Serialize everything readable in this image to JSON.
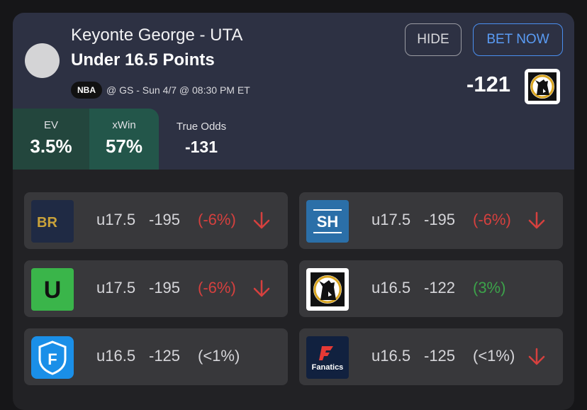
{
  "player": {
    "name": "Keyonte George - UTA",
    "line": "Under 16.5 Points"
  },
  "game": {
    "league": "NBA",
    "info": "@ GS - Sun 4/7 @ 08:30 PM ET"
  },
  "buttons": {
    "hide": "HIDE",
    "bet_now": "BET NOW"
  },
  "best_odds": "-121",
  "stats": {
    "ev": {
      "label": "EV",
      "value": "3.5%"
    },
    "xwin": {
      "label": "xWin",
      "value": "57%"
    },
    "true_odds": {
      "label": "True Odds",
      "value": "-131"
    }
  },
  "books": [
    {
      "logo": "BR",
      "line": "u17.5",
      "odds": "-195",
      "diff": "(-6%)",
      "trend": "down"
    },
    {
      "logo": "SH",
      "line": "u17.5",
      "odds": "-195",
      "diff": "(-6%)",
      "trend": "down"
    },
    {
      "logo": "U",
      "line": "u17.5",
      "odds": "-195",
      "diff": "(-6%)",
      "trend": "down"
    },
    {
      "logo": "bull-mascot-icon",
      "line": "u16.5",
      "odds": "-122",
      "diff": "(3%)",
      "trend": "none"
    },
    {
      "logo": "F",
      "line": "u16.5",
      "odds": "-125",
      "diff": "(<1%)",
      "trend": "none"
    },
    {
      "logo": "Fanatics",
      "line": "u16.5",
      "odds": "-125",
      "diff": "(<1%)",
      "trend": "down"
    }
  ],
  "colors": {
    "negative": "#d6403e",
    "positive": "#3ca24a",
    "accent": "#4a8ff0"
  }
}
